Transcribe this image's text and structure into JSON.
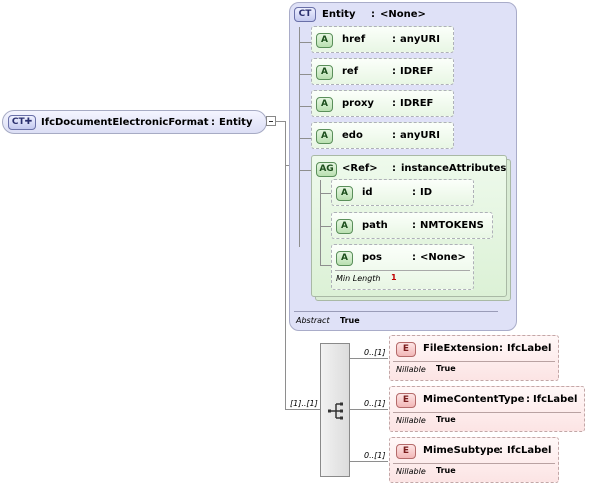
{
  "root": {
    "tag": "CT",
    "name": "IfcDocumentElectronicFormat",
    "sep": ":",
    "type": "Entity"
  },
  "entity": {
    "tag": "CT",
    "name": "Entity",
    "sep": ":",
    "type": "<None>",
    "abstract_label": "Abstract",
    "abstract_value": "True",
    "attributes": [
      {
        "tag": "A",
        "name": "href",
        "sep": ":",
        "type": "anyURI"
      },
      {
        "tag": "A",
        "name": "ref",
        "sep": ":",
        "type": "IDREF"
      },
      {
        "tag": "A",
        "name": "proxy",
        "sep": ":",
        "type": "IDREF"
      },
      {
        "tag": "A",
        "name": "edo",
        "sep": ":",
        "type": "anyURI"
      }
    ],
    "group": {
      "tag": "AG",
      "name": "<Ref>",
      "sep": ":",
      "type": "instanceAttributes",
      "attributes": [
        {
          "tag": "A",
          "name": "id",
          "sep": ":",
          "type": "ID"
        },
        {
          "tag": "A",
          "name": "path",
          "sep": ":",
          "type": "NMTOKENS"
        },
        {
          "tag": "A",
          "name": "pos",
          "sep": ":",
          "type": "<None>",
          "facet_label": "Min Length",
          "facet_value": "1"
        }
      ]
    }
  },
  "sequence": {
    "cardinality": "[1]..[1]",
    "elements": [
      {
        "tag": "E",
        "name": "FileExtension",
        "sep": ":",
        "type": "IfcLabel",
        "cardinality": "0..[1]",
        "facet_label": "Nillable",
        "facet_value": "True"
      },
      {
        "tag": "E",
        "name": "MimeContentType",
        "sep": ":",
        "type": "IfcLabel",
        "cardinality": "0..[1]",
        "facet_label": "Nillable",
        "facet_value": "True"
      },
      {
        "tag": "E",
        "name": "MimeSubtype",
        "sep": ":",
        "type": "IfcLabel",
        "cardinality": "0..[1]",
        "facet_label": "Nillable",
        "facet_value": "True"
      }
    ]
  },
  "colors": {
    "entity_bg": "#dfe1f7",
    "group_bg": "#e4f5e0",
    "element_bg": "#fce4e4",
    "connector": "#8e8e8e"
  }
}
